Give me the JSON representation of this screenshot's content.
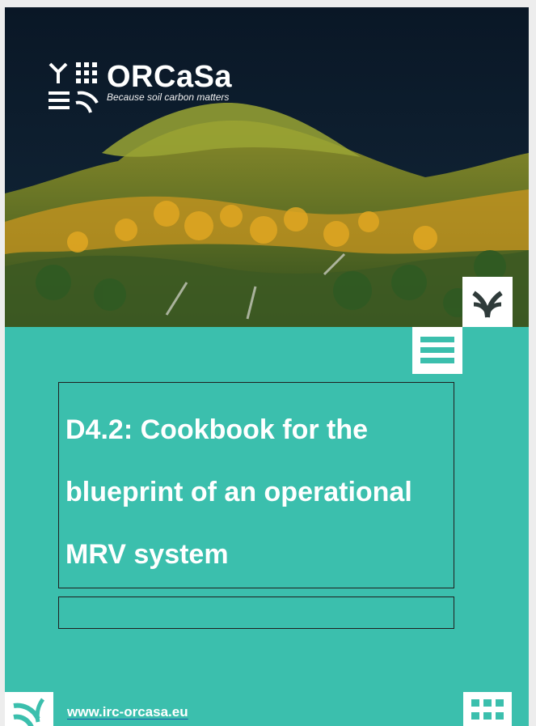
{
  "logo": {
    "name": "ORCaSa",
    "tagline": "Because soil carbon matters"
  },
  "icons": {
    "logo_mark": "orcasa-mark-icon",
    "plant": "plant-icon",
    "lines": "lines-icon",
    "grid": "grid-icon"
  },
  "document": {
    "title": "D4.2: Cookbook for the blueprint of an operational MRV system",
    "subtitle": ""
  },
  "footer": {
    "url": "www.irc-orcasa.eu"
  },
  "colors": {
    "brand_teal": "#3bbfad",
    "tile": "#ffffff"
  }
}
